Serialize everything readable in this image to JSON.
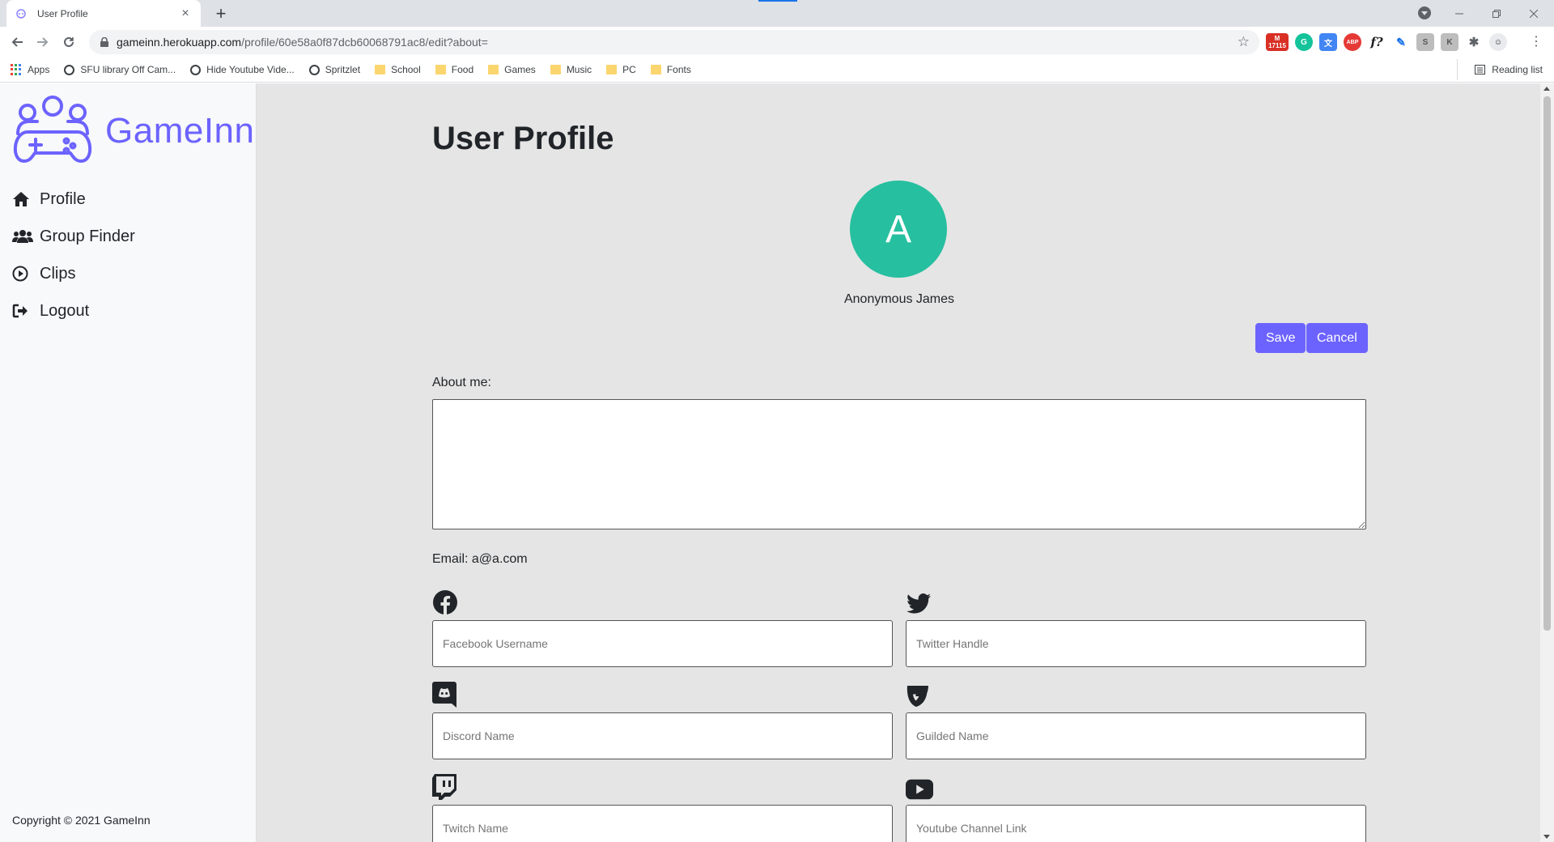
{
  "browser": {
    "tab_title": "User Profile",
    "tab_close": "×",
    "new_tab": "+",
    "url_host": "gameinn.herokuapp.com",
    "url_path": "/profile/60e58a0f87dcb60068791ac8/edit?about=",
    "extension_badge": "17115",
    "reading_list": "Reading list",
    "bookmarks": [
      {
        "label": "Apps",
        "icon": "apps-grid-icon"
      },
      {
        "label": "SFU library Off Cam...",
        "icon": "globe-icon"
      },
      {
        "label": "Hide Youtube Vide...",
        "icon": "globe-icon"
      },
      {
        "label": "Spritzlet",
        "icon": "globe-icon"
      },
      {
        "label": "School",
        "icon": "folder-icon"
      },
      {
        "label": "Food",
        "icon": "folder-icon"
      },
      {
        "label": "Games",
        "icon": "folder-icon"
      },
      {
        "label": "Music",
        "icon": "folder-icon"
      },
      {
        "label": "PC",
        "icon": "folder-icon"
      },
      {
        "label": "Fonts",
        "icon": "folder-icon"
      }
    ]
  },
  "sidebar": {
    "brand": "GameInn",
    "items": [
      {
        "label": "Profile",
        "icon": "home-icon"
      },
      {
        "label": "Group Finder",
        "icon": "users-icon"
      },
      {
        "label": "Clips",
        "icon": "play-circle-icon"
      },
      {
        "label": "Logout",
        "icon": "logout-icon"
      }
    ],
    "copyright": "Copyright © 2021 GameInn"
  },
  "profile": {
    "title": "User Profile",
    "avatar_letter": "A",
    "user_name": "Anonymous James",
    "save_label": "Save",
    "cancel_label": "Cancel",
    "about_label": "About me:",
    "about_value": "",
    "email_text": "Email: a@a.com"
  },
  "socials": {
    "facebook": {
      "placeholder": "Facebook Username",
      "icon": "facebook-icon"
    },
    "twitter": {
      "placeholder": "Twitter Handle",
      "icon": "twitter-icon"
    },
    "discord": {
      "placeholder": "Discord Name",
      "icon": "discord-icon"
    },
    "guilded": {
      "placeholder": "Guilded Name",
      "icon": "guilded-icon"
    },
    "twitch": {
      "placeholder": "Twitch Name",
      "icon": "twitch-icon"
    },
    "youtube": {
      "placeholder": "Youtube Channel Link",
      "icon": "youtube-icon"
    }
  },
  "colors": {
    "accent": "#6c63ff",
    "avatar": "#26bf9f",
    "page_bg": "#e5e5e5"
  }
}
